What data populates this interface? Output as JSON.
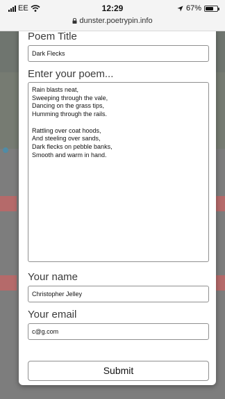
{
  "status_bar": {
    "carrier": "EE",
    "time": "12:29",
    "battery": "67%",
    "battery_level": 0.67,
    "url": "dunster.poetrypin.info"
  },
  "form": {
    "title_label": "Poem Title",
    "title_value": "Dark Flecks",
    "poem_label": "Enter your poem...",
    "poem_value": "Rain blasts neat,\nSweeping through the vale,\nDancing on the grass tips,\nHumming through the rails.\n\nRattling over coat hoods,\nAnd steeling over sands,\nDark flecks on pebble banks,\nSmooth and warm in hand.",
    "name_label": "Your name",
    "name_value": "Christopher Jelley",
    "email_label": "Your email",
    "email_value": "c@g.com",
    "submit_label": "Submit"
  },
  "icons": {
    "signal": "cellular-signal-icon",
    "wifi": "wifi-icon",
    "location": "location-arrow-icon",
    "battery": "battery-icon",
    "lock": "lock-icon"
  },
  "colors": {
    "backdrop": "#7d7d7d",
    "modal": "#ffffff",
    "border": "#8f8f8f"
  }
}
